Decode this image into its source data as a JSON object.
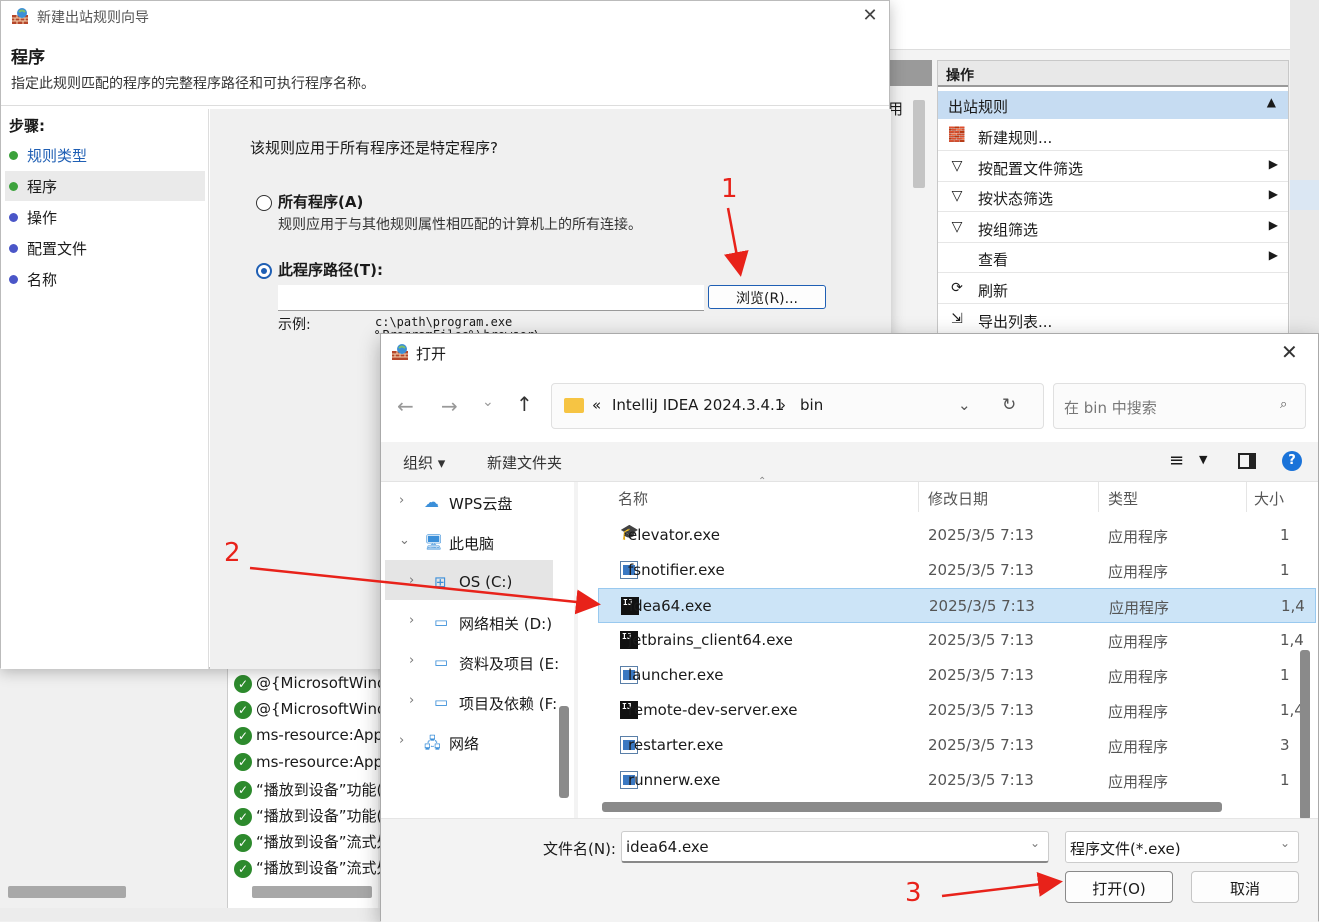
{
  "background": {
    "actions": {
      "header": "操作",
      "section": "出站规则",
      "items": [
        {
          "label": "新建规则...",
          "icon": "new-rule-icon",
          "arrow": false
        },
        {
          "label": "按配置文件筛选",
          "icon": "filter-icon",
          "arrow": true
        },
        {
          "label": "按状态筛选",
          "icon": "filter-icon",
          "arrow": true
        },
        {
          "label": "按组筛选",
          "icon": "filter-icon",
          "arrow": true
        },
        {
          "label": "查看",
          "icon": "",
          "arrow": true
        },
        {
          "label": "刷新",
          "icon": "refresh-icon",
          "arrow": false
        },
        {
          "label": "导出列表...",
          "icon": "export-icon",
          "arrow": false
        }
      ]
    },
    "partial_col": "用",
    "rules": [
      "@{MicrosoftWind",
      "@{MicrosoftWind",
      "ms-resource:AppD",
      "ms-resource:AppD",
      "“播放到设备”功能(",
      "“播放到设备”功能(",
      "“播放到设备”流式处",
      "“播放到设备”流式处"
    ]
  },
  "wizard": {
    "title": "新建出站规则向导",
    "heading": "程序",
    "subheading": "指定此规则匹配的程序的完整程序路径和可执行程序名称。",
    "steps_label": "步骤:",
    "steps": [
      {
        "label": "规则类型",
        "state": "done"
      },
      {
        "label": "程序",
        "state": "current"
      },
      {
        "label": "操作",
        "state": "pending"
      },
      {
        "label": "配置文件",
        "state": "pending"
      },
      {
        "label": "名称",
        "state": "pending"
      }
    ],
    "question": "该规则应用于所有程序还是特定程序?",
    "all_programs_label": "所有程序(A)",
    "all_programs_desc": "规则应用于与其他规则属性相匹配的计算机上的所有连接。",
    "this_path_label": "此程序路径(T):",
    "path_value": "",
    "browse_label": "浏览(R)...",
    "example_label": "示例:",
    "example_1": "c:\\path\\program.exe",
    "example_2": "%ProgramFiles%\\browser\\"
  },
  "open_dialog": {
    "title": "打开",
    "breadcrumb": [
      "«",
      "IntelliJ IDEA 2024.3.4.1",
      "›",
      "bin"
    ],
    "search_placeholder": "在 bin 中搜索",
    "organize_label": "组织 ▾",
    "new_folder_label": "新建文件夹",
    "nav": [
      {
        "label": "WPS云盘",
        "chevron": "›",
        "icon": "cloud-icon"
      },
      {
        "label": "此电脑",
        "chevron": "⌄",
        "icon": "computer-icon"
      },
      {
        "label": "OS (C:)",
        "chevron": "›",
        "icon": "windows-drive-icon"
      },
      {
        "label": "网络相关 (D:)",
        "chevron": "›",
        "icon": "drive-icon"
      },
      {
        "label": "资料及项目 (E:",
        "chevron": "›",
        "icon": "drive-icon"
      },
      {
        "label": "项目及依赖 (F:",
        "chevron": "›",
        "icon": "drive-icon"
      },
      {
        "label": "网络",
        "chevron": "›",
        "icon": "network-icon"
      }
    ],
    "columns": {
      "name": "名称",
      "date": "修改日期",
      "type": "类型",
      "size": "大小"
    },
    "files": [
      {
        "name": "elevator.exe",
        "date": "2025/3/5 7:13",
        "type": "应用程序",
        "size": "1",
        "icon": "elevator"
      },
      {
        "name": "fsnotifier.exe",
        "date": "2025/3/5 7:13",
        "type": "应用程序",
        "size": "1",
        "icon": "exe"
      },
      {
        "name": "idea64.exe",
        "date": "2025/3/5 7:13",
        "type": "应用程序",
        "size": "1,4",
        "icon": "ij"
      },
      {
        "name": "jetbrains_client64.exe",
        "date": "2025/3/5 7:13",
        "type": "应用程序",
        "size": "1,4",
        "icon": "ij"
      },
      {
        "name": "launcher.exe",
        "date": "2025/3/5 7:13",
        "type": "应用程序",
        "size": "1",
        "icon": "exe"
      },
      {
        "name": "remote-dev-server.exe",
        "date": "2025/3/5 7:13",
        "type": "应用程序",
        "size": "1,4",
        "icon": "ij"
      },
      {
        "name": "restarter.exe",
        "date": "2025/3/5 7:13",
        "type": "应用程序",
        "size": "3",
        "icon": "exe"
      },
      {
        "name": "runnerw.exe",
        "date": "2025/3/5 7:13",
        "type": "应用程序",
        "size": "1",
        "icon": "exe"
      }
    ],
    "selected_index": 2,
    "filename_label": "文件名(N):",
    "filename_value": "idea64.exe",
    "filetype_value": "程序文件(*.exe)",
    "open_label": "打开(O)",
    "cancel_label": "取消"
  },
  "annotations": [
    "1",
    "2",
    "3"
  ],
  "colors": {
    "accent": "#1f5fb4",
    "selected_row": "#cce4f7",
    "annotation": "#e8221a"
  }
}
